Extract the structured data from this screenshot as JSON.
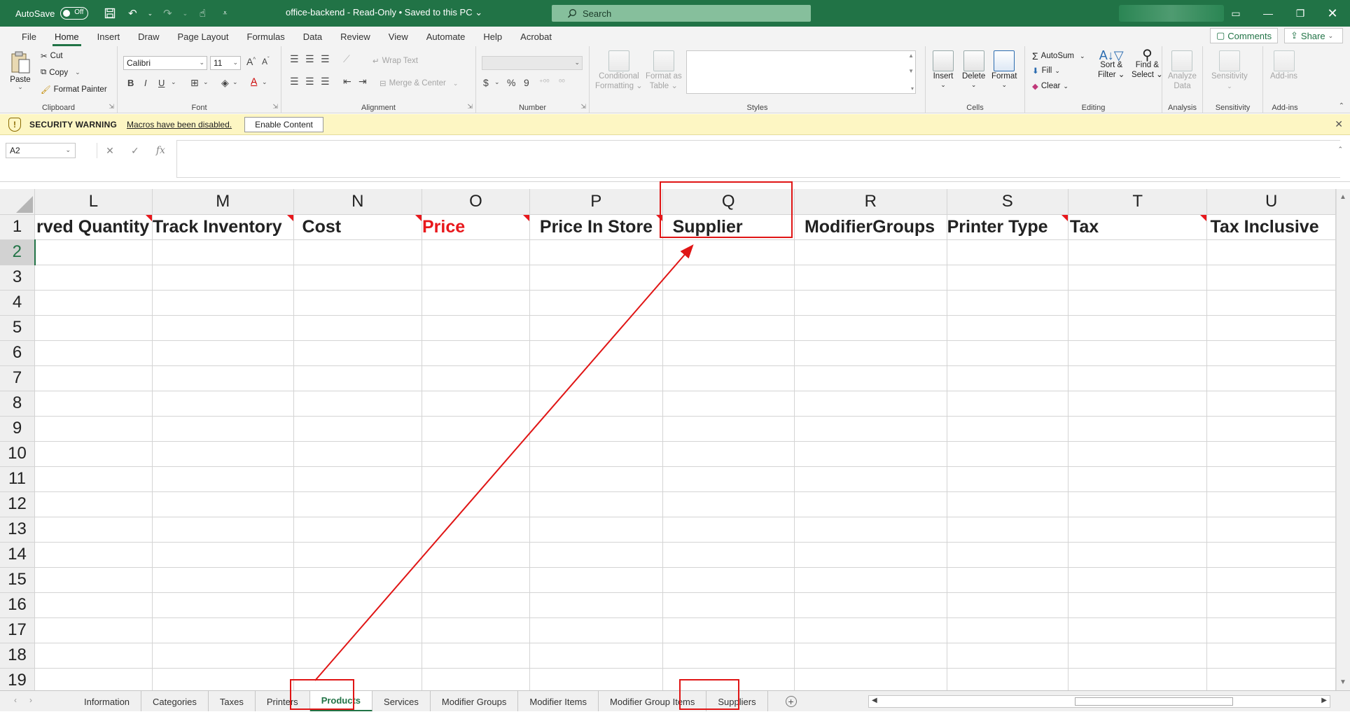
{
  "titlebar": {
    "autosave_label": "AutoSave",
    "autosave_state": "Off",
    "document_title": "office-backend  -  Read-Only  •  Saved to this PC ⌄",
    "search_placeholder": "Search"
  },
  "ribbon_tabs": [
    "File",
    "Home",
    "Insert",
    "Draw",
    "Page Layout",
    "Formulas",
    "Data",
    "Review",
    "View",
    "Automate",
    "Help",
    "Acrobat"
  ],
  "ribbon_actions": {
    "comments": "Comments",
    "share": "Share"
  },
  "ribbon": {
    "clipboard": {
      "label": "Clipboard",
      "paste": "Paste",
      "cut": "Cut",
      "copy": "Copy",
      "format_painter": "Format Painter"
    },
    "font": {
      "label": "Font",
      "font_name": "Calibri",
      "font_size": "11"
    },
    "alignment": {
      "label": "Alignment",
      "wrap_text": "Wrap Text",
      "merge_center": "Merge & Center"
    },
    "number": {
      "label": "Number"
    },
    "styles": {
      "label": "Styles",
      "conditional_1": "Conditional",
      "conditional_2": "Formatting",
      "format_table_1": "Format as",
      "format_table_2": "Table"
    },
    "cells": {
      "label": "Cells",
      "insert": "Insert",
      "delete": "Delete",
      "format": "Format"
    },
    "editing": {
      "label": "Editing",
      "autosum": "AutoSum",
      "fill": "Fill",
      "clear": "Clear",
      "sort_1": "Sort &",
      "sort_2": "Filter",
      "find_1": "Find &",
      "find_2": "Select"
    },
    "analysis": {
      "label": "Analysis",
      "analyze_1": "Analyze",
      "analyze_2": "Data"
    },
    "sensitivity": {
      "label": "Sensitivity",
      "btn": "Sensitivity"
    },
    "addins": {
      "label": "Add-ins",
      "btn": "Add-ins"
    }
  },
  "security_bar": {
    "title": "SECURITY WARNING",
    "message": "Macros have been disabled.",
    "button": "Enable Content"
  },
  "formula_bar": {
    "name_box": "A2",
    "fx": "fx",
    "value": ""
  },
  "grid": {
    "columns": [
      "L",
      "M",
      "N",
      "O",
      "P",
      "Q",
      "R",
      "S",
      "T",
      "U"
    ],
    "header_row": [
      "rved Quantity",
      "Track Inventory",
      "Cost",
      "Price",
      "Price In Store",
      "Supplier",
      "ModifierGroups",
      "Printer Type",
      "Tax",
      "Tax Inclusive"
    ],
    "rows": [
      "1",
      "2",
      "3",
      "4",
      "5",
      "6",
      "7",
      "8",
      "9",
      "10",
      "11",
      "12",
      "13",
      "14",
      "15",
      "16",
      "17",
      "18",
      "19"
    ]
  },
  "sheet_tabs": [
    "Information",
    "Categories",
    "Taxes",
    "Printers",
    "Products",
    "Services",
    "Modifier Groups",
    "Modifier Items",
    "Modifier Group Items",
    "Suppliers"
  ],
  "active_sheet": "Products",
  "colors": {
    "excel_green": "#217346",
    "annotation_red": "#e01515",
    "price_red": "#e8171b"
  }
}
